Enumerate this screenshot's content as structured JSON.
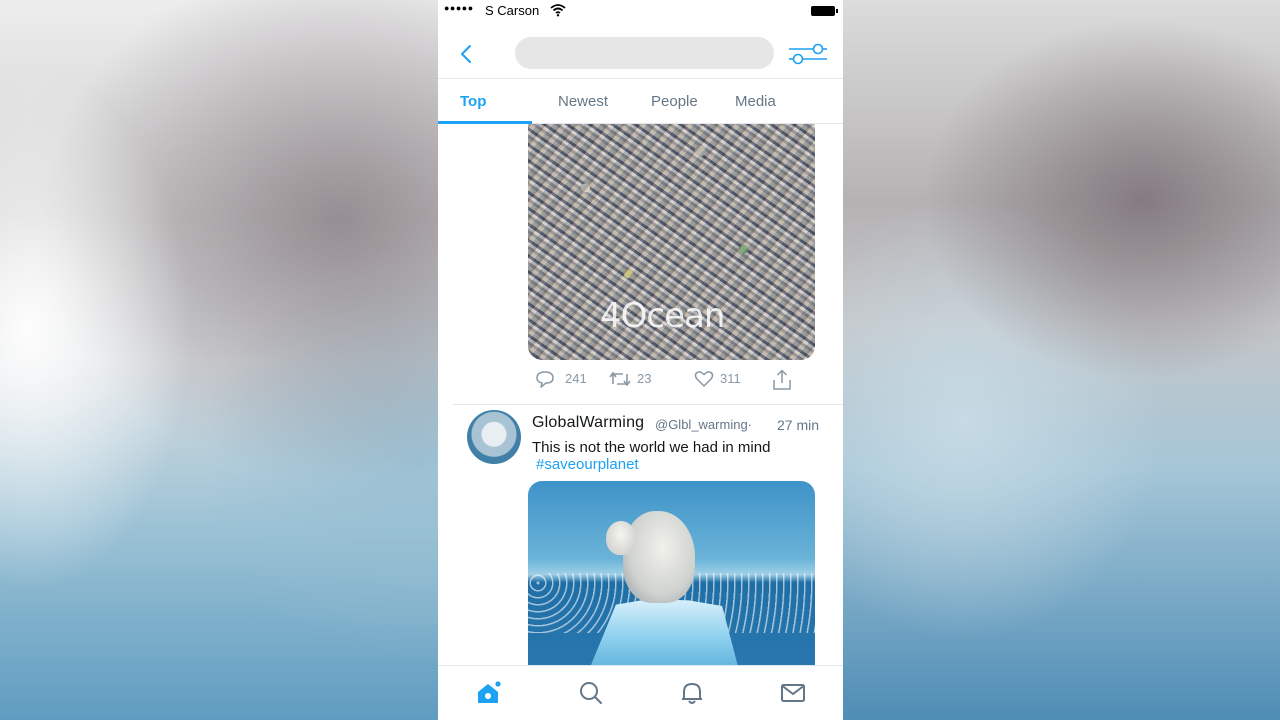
{
  "status_bar": {
    "signal_dots": "●●●●●",
    "carrier": "S Carson"
  },
  "search": {
    "placeholder": ""
  },
  "tabs": [
    {
      "label": "Top",
      "active": true
    },
    {
      "label": "Newest",
      "active": false
    },
    {
      "label": "People",
      "active": false
    },
    {
      "label": "Media",
      "active": false
    }
  ],
  "tweet_1": {
    "media_watermark": "4Ocean",
    "reply_count": "241",
    "retweet_count": "23",
    "like_count": "311"
  },
  "tweet_2": {
    "author": "GlobalWarming",
    "handle": "@Glbl_warming·",
    "time": "27 min",
    "text": "This is not the world we had in mind",
    "hashtag": "#saveourplanet"
  },
  "bottom_tabs": [
    "home-icon",
    "search-icon",
    "notifications-icon",
    "messages-icon"
  ],
  "colors": {
    "accent": "#1da1f2",
    "muted": "#657786",
    "icon_gray": "#8899a6"
  }
}
